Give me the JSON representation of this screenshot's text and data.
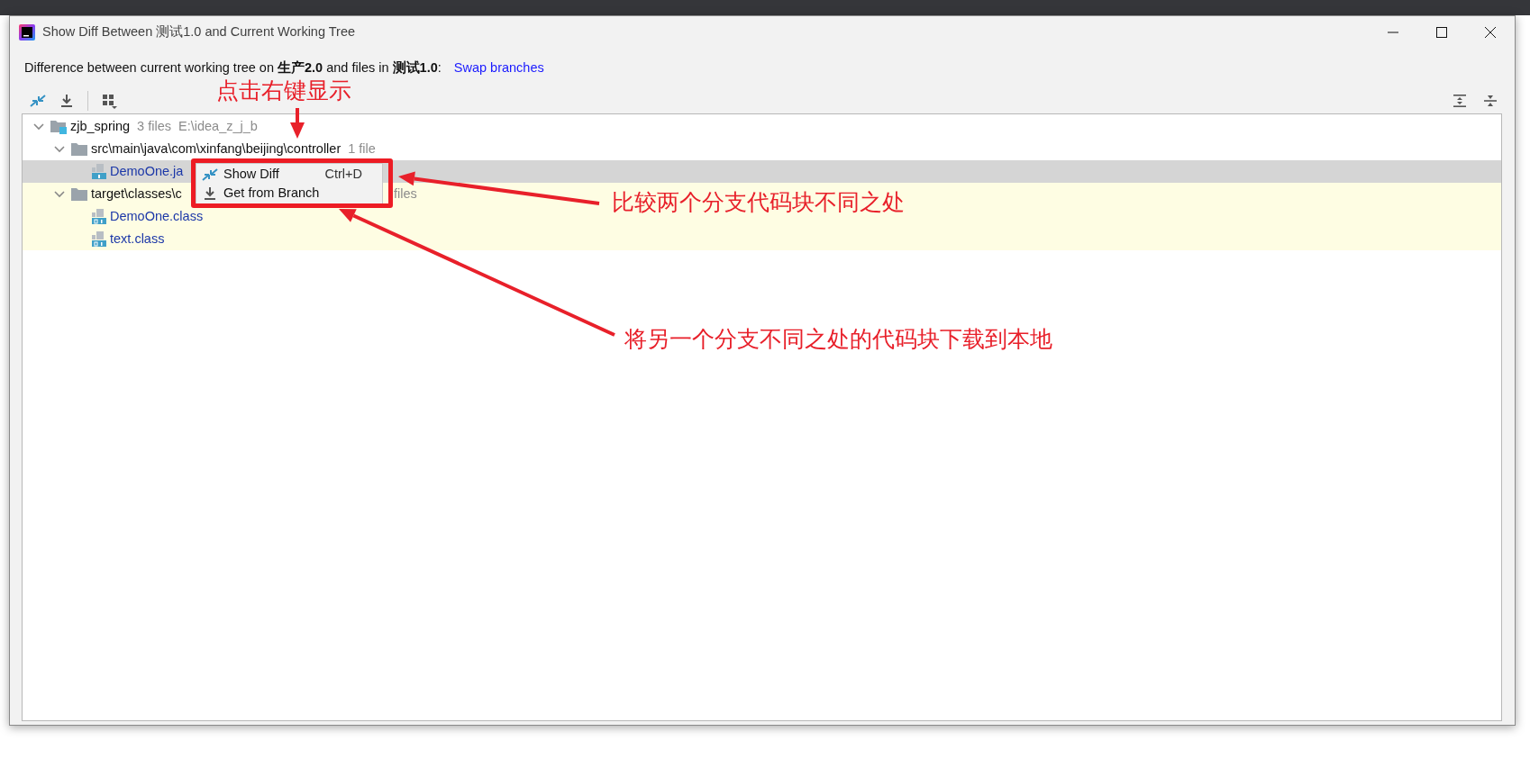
{
  "window": {
    "title": "Show Diff Between 测试1.0 and Current Working Tree"
  },
  "header": {
    "text": "Difference between current working tree on **生产2.0** and files in **测试1.0**:",
    "link": "Swap branches"
  },
  "tree": [
    {
      "name": "zjb_spring",
      "kind": "module",
      "info": "3 files",
      "path": "E:\\idea_z_j_b",
      "expanded": true,
      "selected": false,
      "highlighted": false,
      "children": [
        {
          "name": "src\\main\\java\\com\\xinfang\\beijing\\controller",
          "kind": "folder",
          "info": "1 file",
          "expanded": true,
          "selected": false,
          "highlighted": false,
          "children": [
            {
              "name": "DemoOne.ja",
              "kind": "java",
              "selected": true,
              "highlighted": false
            }
          ]
        },
        {
          "name": "target\\classes\\c",
          "kind": "folder",
          "info": "files",
          "expanded": true,
          "selected": false,
          "highlighted": true,
          "children": [
            {
              "name": "DemoOne.class",
              "kind": "class",
              "selected": false,
              "highlighted": true
            },
            {
              "name": "text.class",
              "kind": "class",
              "selected": false,
              "highlighted": true
            }
          ]
        }
      ]
    }
  ],
  "context_menu": [
    {
      "label": "Show Diff",
      "shortcut": "Ctrl+D",
      "kind": "compare"
    },
    {
      "label": "Get from Branch",
      "kind": "download"
    }
  ],
  "callouts": [
    {
      "text": "点击右键显示"
    },
    {
      "text": "比较两个分支代码块不同之处"
    },
    {
      "text": "将另一个分支不同之处的代码块下载到本地"
    }
  ]
}
